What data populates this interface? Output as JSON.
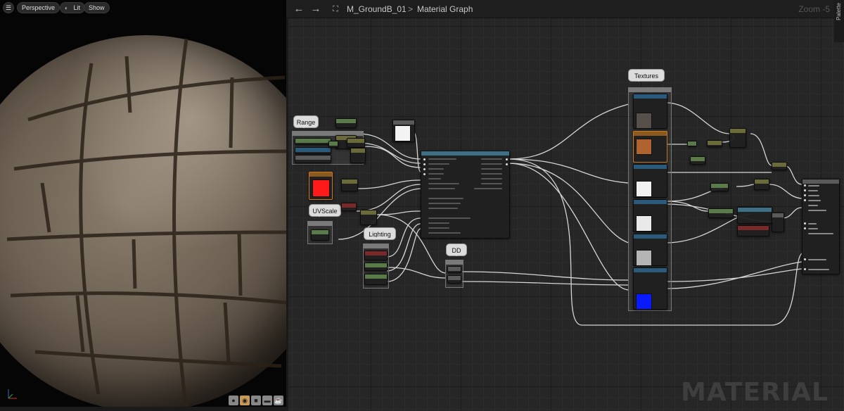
{
  "viewport": {
    "perspective_label": "Perspective",
    "lit_label": "Lit",
    "show_label": "Show",
    "menu_icon": "hamburger-icon",
    "lit_icon": "sun-icon",
    "tool_icons": [
      "sphere-icon",
      "texture-icon",
      "cube-icon",
      "plane-icon",
      "teapot-icon"
    ]
  },
  "graph": {
    "asset_name": "M_GroundB_01",
    "breadcrumb_separator": ">",
    "graph_name": "Material Graph",
    "zoom_label": "Zoom -5",
    "palette_label": "Palette",
    "watermark": "MATERIAL",
    "back_icon": "arrow-left-icon",
    "forward_icon": "arrow-right-icon",
    "asset_icon": "material-graph-icon"
  },
  "comments": {
    "range": "Range",
    "uvscale": "UVScale",
    "lighting": "Lighting",
    "dd": "DD",
    "textures": "Textures"
  },
  "colors": {
    "wire": "#e8e8e8",
    "red_param": "#ff1a1a",
    "blue_texture": "#0a1aff",
    "orange_texture": "#b0622f"
  }
}
